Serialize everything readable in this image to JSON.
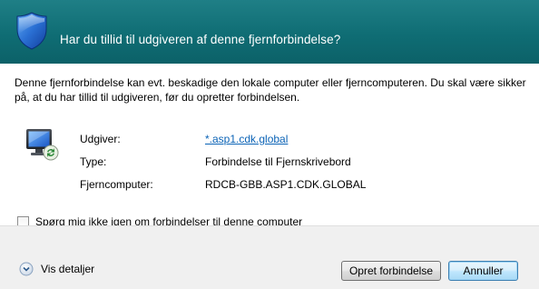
{
  "header": {
    "title": "Har du tillid til udgiveren af denne fjernforbindelse?"
  },
  "message": {
    "text": "Denne fjernforbindelse kan evt. beskadige den lokale computer eller fjerncomputeren. Du skal være sikker på, at du har tillid til udgiveren, før du opretter forbindelsen."
  },
  "details_rows": [
    {
      "label": "Udgiver:",
      "value": "*.asp1.cdk.global"
    },
    {
      "label": "Type:",
      "value": "Forbindelse til Fjernskrivebord"
    },
    {
      "label": "Fjerncomputer:",
      "value": "RDCB-GBB.ASP1.CDK.GLOBAL"
    }
  ],
  "checkbox": {
    "label": "Spørg mig ikke igen om forbindelser til denne computer",
    "checked": false
  },
  "footer": {
    "details_label": "Vis detaljer",
    "connect_label": "Opret forbindelse",
    "cancel_label": "Annuller"
  },
  "colors": {
    "header_bg": "#0f6d74",
    "link": "#0b63b6"
  },
  "icons": {
    "header": "shield-icon",
    "computer": "remote-computer-icon",
    "expand": "chevron-down-icon"
  }
}
